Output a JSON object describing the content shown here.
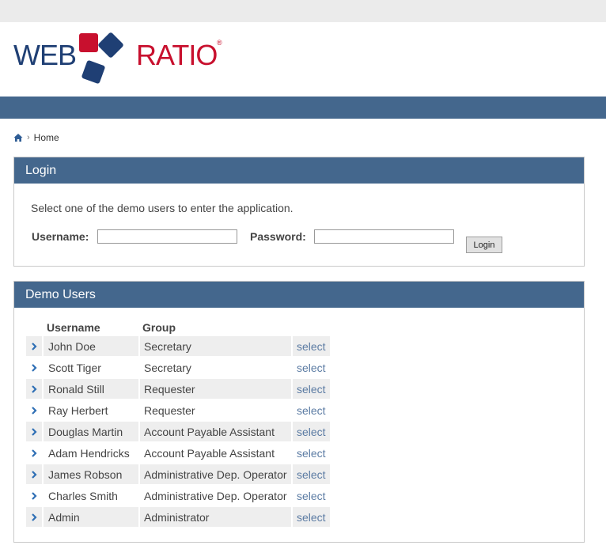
{
  "logo": {
    "left_text": "WEB",
    "right_text": "RATIO",
    "reg_mark": "®"
  },
  "colors": {
    "brand_blue": "#1f3f74",
    "brand_red": "#c8102e",
    "bar": "#44678d",
    "link": "#5b7ba3"
  },
  "breadcrumb": {
    "home_icon": "home-icon",
    "label": "Home"
  },
  "login": {
    "title": "Login",
    "message": "Select one of the demo users to enter the application.",
    "username_label": "Username:",
    "password_label": "Password:",
    "username_value": "",
    "password_value": "",
    "button": "Login"
  },
  "demo_users": {
    "title": "Demo Users",
    "columns": [
      "Username",
      "Group"
    ],
    "select_label": "select",
    "rows": [
      {
        "name": "John Doe",
        "group": "Secretary"
      },
      {
        "name": "Scott Tiger",
        "group": "Secretary"
      },
      {
        "name": "Ronald Still",
        "group": "Requester"
      },
      {
        "name": "Ray Herbert",
        "group": "Requester"
      },
      {
        "name": "Douglas Martin",
        "group": "Account Payable Assistant"
      },
      {
        "name": "Adam Hendricks",
        "group": "Account Payable Assistant"
      },
      {
        "name": "James Robson",
        "group": "Administrative Dep. Operator"
      },
      {
        "name": "Charles Smith",
        "group": "Administrative Dep. Operator"
      },
      {
        "name": "Admin",
        "group": "Administrator"
      }
    ]
  }
}
